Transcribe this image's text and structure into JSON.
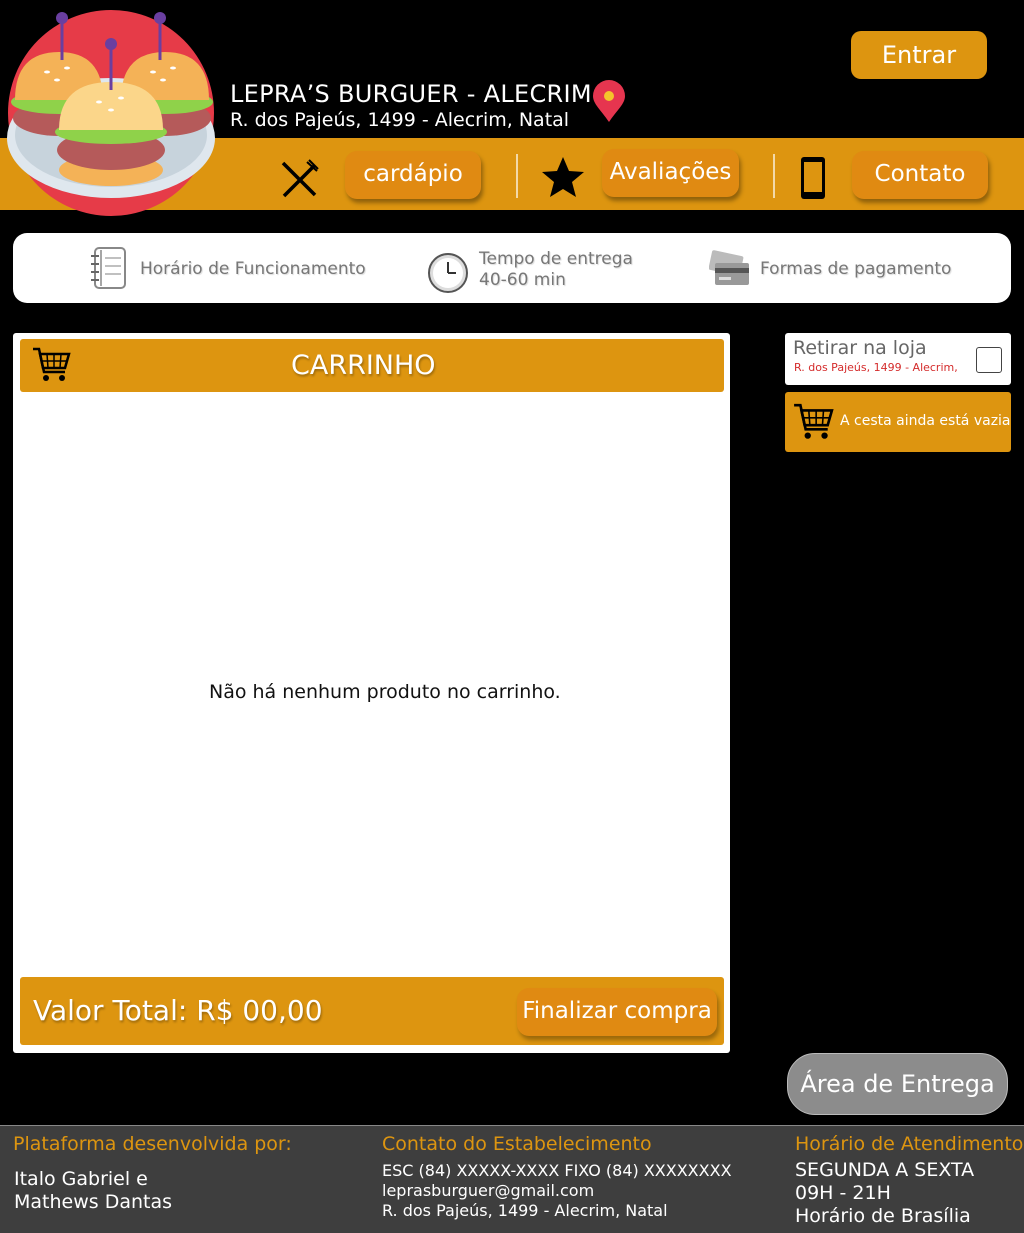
{
  "header": {
    "title": "LEPRA’S BURGUER - ALECRIM",
    "address": "R. dos Pajeús, 1499 - Alecrim, Natal",
    "login_label": "Entrar"
  },
  "nav": {
    "menu_label": "cardápio",
    "reviews_label": "Avaliações",
    "contact_label": "Contato"
  },
  "info": {
    "hours_label": "Horário de Funcionamento",
    "delivery_time_label": "Tempo de entrega",
    "delivery_time_value": "40-60 min",
    "payment_label": "Formas de pagamento"
  },
  "cart": {
    "title": "CARRINHO",
    "empty_message": "Não há nenhum produto no carrinho.",
    "total_label": "Valor Total: R$ 00,00",
    "checkout_label": "Finalizar compra"
  },
  "side": {
    "pickup_label": "Retirar na loja",
    "pickup_address": "R. dos Pajeús, 1499 - Alecrim,",
    "basket_empty": "A cesta ainda está vazia",
    "delivery_area_label": "Área de Entrega"
  },
  "footer": {
    "dev_heading": "Plataforma desenvolvida por:",
    "dev_line1": "Italo Gabriel e",
    "dev_line2": "Mathews Dantas",
    "contact_heading": "Contato do Estabelecimento",
    "contact_phones": "ESC (84) XXXXX-XXXX FIXO (84) XXXXXXXX",
    "contact_email": "leprasburguer@gmail.com",
    "contact_address": "R. dos Pajeús, 1499 - Alecrim, Natal",
    "hours_heading": "Horário de Atendimento",
    "hours_days": "SEGUNDA A SEXTA",
    "hours_time": "09H - 21H",
    "hours_zone": "Horário de Brasília"
  },
  "colors": {
    "accent": "#dd9510",
    "background": "#000000",
    "footer": "#3e3e3e",
    "pickup_address": "#d42b2b"
  },
  "icons": [
    "burger-logo",
    "map-pin-icon",
    "cutlery-icon",
    "star-icon",
    "phone-icon",
    "notebook-icon",
    "clock-icon",
    "credit-card-icon",
    "cart-icon",
    "checkbox"
  ]
}
